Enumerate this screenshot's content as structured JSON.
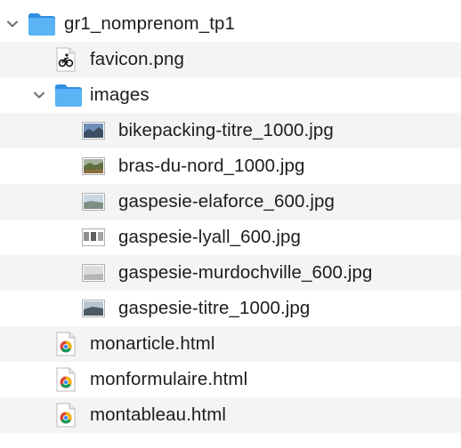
{
  "tree": {
    "root": {
      "label": "gr1_nomprenom_tp1",
      "expanded": true,
      "icon": "folder-icon"
    },
    "favicon": {
      "label": "favicon.png",
      "icon": "png-file-icon"
    },
    "images_folder": {
      "label": "images",
      "expanded": true,
      "icon": "folder-icon"
    },
    "image_files": [
      {
        "label": "bikepacking-titre_1000.jpg",
        "icon": "jpg-thumbnail-icon"
      },
      {
        "label": "bras-du-nord_1000.jpg",
        "icon": "jpg-thumbnail-icon"
      },
      {
        "label": "gaspesie-elaforce_600.jpg",
        "icon": "jpg-thumbnail-icon"
      },
      {
        "label": "gaspesie-lyall_600.jpg",
        "icon": "jpg-thumbnail-icon"
      },
      {
        "label": "gaspesie-murdochville_600.jpg",
        "icon": "jpg-thumbnail-icon"
      },
      {
        "label": "gaspesie-titre_1000.jpg",
        "icon": "jpg-thumbnail-icon"
      }
    ],
    "html_files": [
      {
        "label": "monarticle.html",
        "icon": "chrome-html-icon"
      },
      {
        "label": "monformulaire.html",
        "icon": "chrome-html-icon"
      },
      {
        "label": "montableau.html",
        "icon": "chrome-html-icon"
      }
    ]
  },
  "colors": {
    "folder": "#3fa3ef",
    "row_alt": "#f4f4f5",
    "text": "#1d1d1f",
    "chevron": "#6e6e73"
  }
}
